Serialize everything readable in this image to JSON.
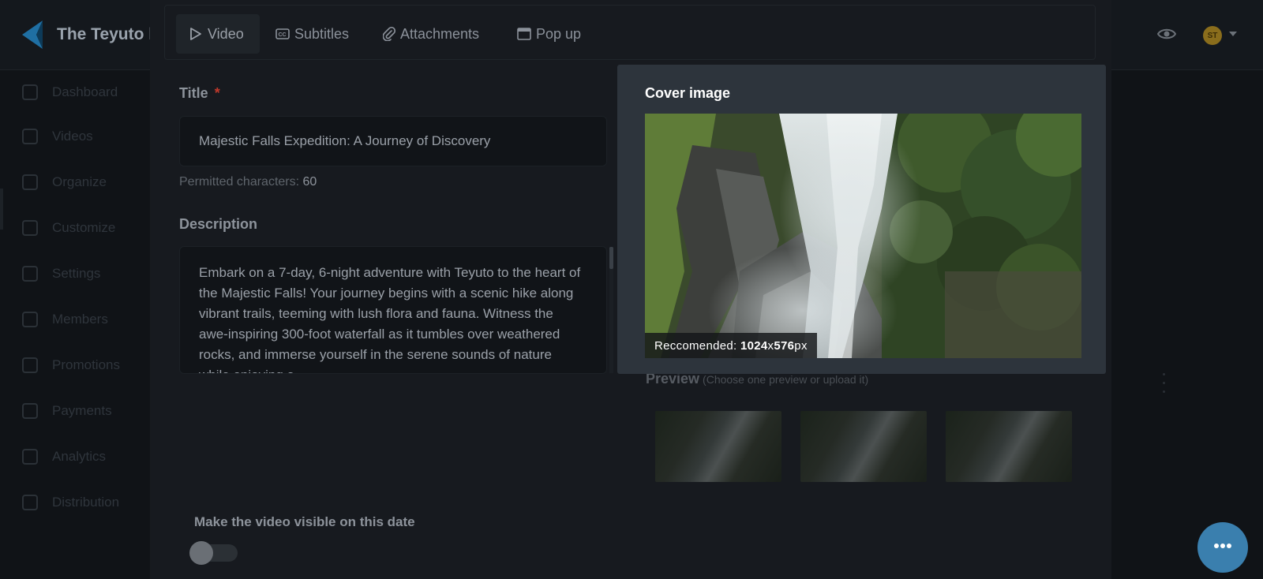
{
  "header": {
    "brand": "The Teyuto l",
    "avatar_initials": "ST"
  },
  "sidebar": {
    "items": [
      {
        "label": "Dashboard",
        "icon": "home-icon"
      },
      {
        "label": "Videos",
        "icon": "video-icon"
      },
      {
        "label": "Organize",
        "icon": "organize-icon"
      },
      {
        "label": "Customize",
        "icon": "brush-icon"
      },
      {
        "label": "Settings",
        "icon": "settings-icon"
      },
      {
        "label": "Members",
        "icon": "members-icon"
      },
      {
        "label": "Promotions",
        "icon": "promotions-icon"
      },
      {
        "label": "Payments",
        "icon": "payments-icon"
      },
      {
        "label": "Analytics",
        "icon": "analytics-icon"
      },
      {
        "label": "Distribution",
        "icon": "distribution-icon"
      }
    ]
  },
  "modal": {
    "tabs": [
      {
        "label": "Video",
        "icon": "play-icon",
        "active": true
      },
      {
        "label": "Subtitles",
        "icon": "cc-icon",
        "active": false
      },
      {
        "label": "Attachments",
        "icon": "paperclip-icon",
        "active": false
      },
      {
        "label": "Pop up",
        "icon": "window-icon",
        "active": false
      }
    ],
    "title_label": "Title",
    "required_mark": "*",
    "title_value": "Majestic Falls Expedition: A Journey of Discovery",
    "permitted_label": "Permitted characters:",
    "permitted_value": "60",
    "description_label": "Description",
    "description_value": "Embark on a 7-day, 6-night adventure with Teyuto to the heart of the Majestic Falls! Your journey begins with a scenic hike along vibrant trails, teeming with lush flora and fauna. Witness the awe-inspiring 300-foot waterfall as it tumbles over weathered rocks, and immerse yourself in the serene sounds of nature while enjoying a",
    "preview_label": "Preview",
    "preview_hint": "(Choose one preview or upload it)",
    "visible_label": "Make the video visible on this date",
    "visible_toggle_on": false
  },
  "cover": {
    "title": "Cover image",
    "rec_prefix": "Reccomended: ",
    "rec_w": "1024",
    "rec_x": "x",
    "rec_h": "576",
    "rec_unit": "px"
  },
  "colors": {
    "accent_chat": "#3a7fae",
    "required": "#c0392b",
    "cover_card": "#2d343c"
  }
}
